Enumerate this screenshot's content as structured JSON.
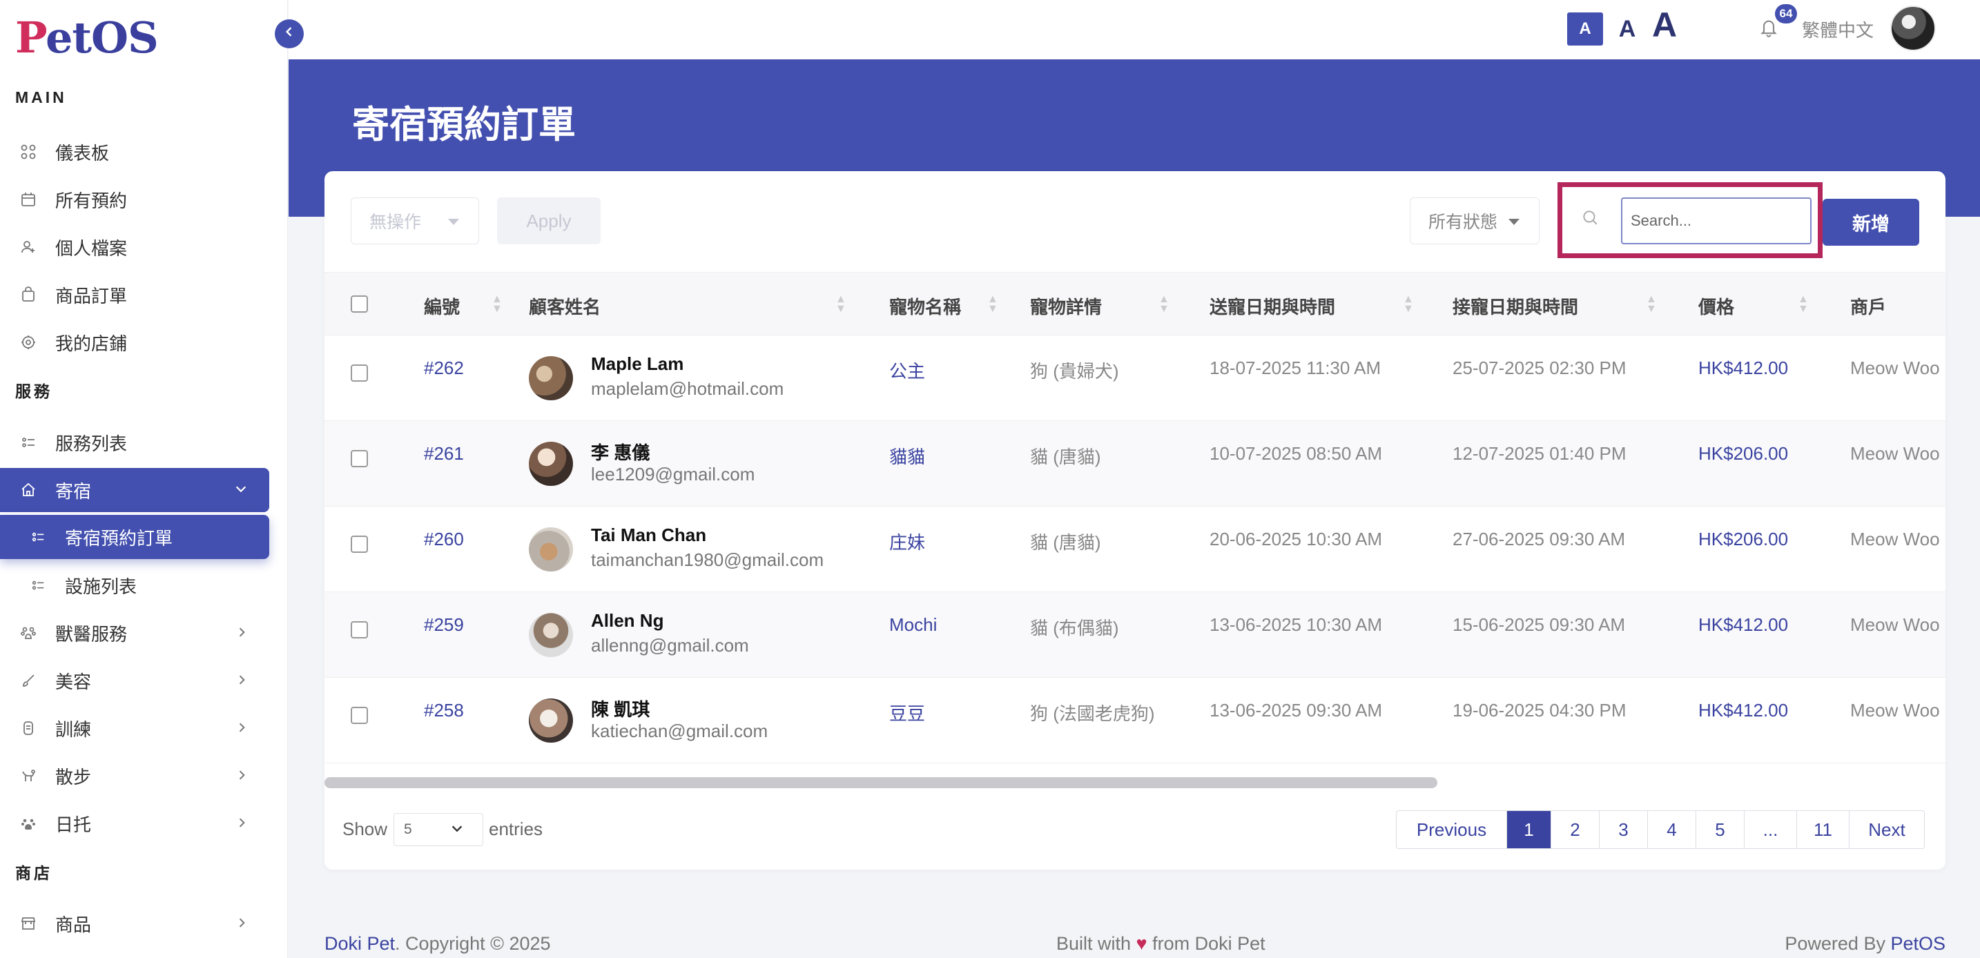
{
  "brand": {
    "logo_p": "P",
    "logo_rest": "etOS"
  },
  "sidebar": {
    "sec_main": "MAIN",
    "sec_services": "服務",
    "sec_shop": "商店",
    "items": [
      {
        "label": "儀表板",
        "icon": "grid-icon"
      },
      {
        "label": "所有預約",
        "icon": "calendar-icon"
      },
      {
        "label": "個人檔案",
        "icon": "user-icon"
      },
      {
        "label": "商品訂單",
        "icon": "bag-icon"
      },
      {
        "label": "我的店鋪",
        "icon": "store-icon"
      },
      {
        "label": "服務列表",
        "icon": "list-icon"
      },
      {
        "label": "寄宿",
        "icon": "home-icon"
      },
      {
        "label": "寄宿預約訂單",
        "icon": "list-icon"
      },
      {
        "label": "設施列表",
        "icon": "list-icon"
      },
      {
        "label": "獸醫服務",
        "icon": "vet-icon"
      },
      {
        "label": "美容",
        "icon": "brush-icon"
      },
      {
        "label": "訓練",
        "icon": "training-icon"
      },
      {
        "label": "散步",
        "icon": "dog-walk-icon"
      },
      {
        "label": "日托",
        "icon": "paw-icon"
      },
      {
        "label": "商品",
        "icon": "shop-icon"
      }
    ]
  },
  "topbar": {
    "font_small": "A",
    "font_medium": "A",
    "font_large": "A",
    "notification_count": "64",
    "language": "繁體中文"
  },
  "page": {
    "title": "寄宿預約訂單"
  },
  "toolbar": {
    "bulk_action": "無操作",
    "apply_label": "Apply",
    "status_filter": "所有狀態",
    "search_placeholder": "Search...",
    "add_label": "新增"
  },
  "table": {
    "headers": [
      "編號",
      "顧客姓名",
      "寵物名稱",
      "寵物詳情",
      "送寵日期與時間",
      "接寵日期與時間",
      "價格",
      "商戶"
    ],
    "rows": [
      {
        "id": "#262",
        "name": "Maple Lam",
        "email": "maplelam@hotmail.com",
        "pet": "公主",
        "detail": "狗 (貴婦犬)",
        "dropoff": "18-07-2025 11:30 AM",
        "pickup": "25-07-2025 02:30 PM",
        "price": "HK$412.00",
        "merchant": "Meow Woo"
      },
      {
        "id": "#261",
        "name": "李 惠儀",
        "email": "lee1209@gmail.com",
        "pet": "貓貓",
        "detail": "貓 (唐貓)",
        "dropoff": "10-07-2025 08:50 AM",
        "pickup": "12-07-2025 01:40 PM",
        "price": "HK$206.00",
        "merchant": "Meow Woo"
      },
      {
        "id": "#260",
        "name": "Tai Man Chan",
        "email": "taimanchan1980@gmail.com",
        "pet": "庄妹",
        "detail": "貓 (唐貓)",
        "dropoff": "20-06-2025 10:30 AM",
        "pickup": "27-06-2025 09:30 AM",
        "price": "HK$206.00",
        "merchant": "Meow Woo"
      },
      {
        "id": "#259",
        "name": "Allen Ng",
        "email": "allenng@gmail.com",
        "pet": "Mochi",
        "detail": "貓 (布偶貓)",
        "dropoff": "13-06-2025 10:30 AM",
        "pickup": "15-06-2025 09:30 AM",
        "price": "HK$412.00",
        "merchant": "Meow Woo"
      },
      {
        "id": "#258",
        "name": "陳 凱琪",
        "email": "katiechan@gmail.com",
        "pet": "豆豆",
        "detail": "狗 (法國老虎狗)",
        "dropoff": "13-06-2025 09:30 AM",
        "pickup": "19-06-2025 04:30 PM",
        "price": "HK$412.00",
        "merchant": "Meow Woo"
      }
    ]
  },
  "pagination": {
    "show_label": "Show",
    "entries_value": "5",
    "entries_label": "entries",
    "previous": "Previous",
    "pages": [
      "1",
      "2",
      "3",
      "4",
      "5",
      "...",
      "11"
    ],
    "next": "Next"
  },
  "footer": {
    "left_brand": "Doki Pet",
    "left_text": ". Copyright © 2025",
    "mid_before": "Built with ",
    "mid_heart": "♥",
    "mid_after": " from Doki Pet",
    "right_text": "Powered By ",
    "right_brand": "PetOS"
  },
  "colors": {
    "primary": "#4350af",
    "accent": "#b5265a",
    "link": "#3a43a0"
  }
}
